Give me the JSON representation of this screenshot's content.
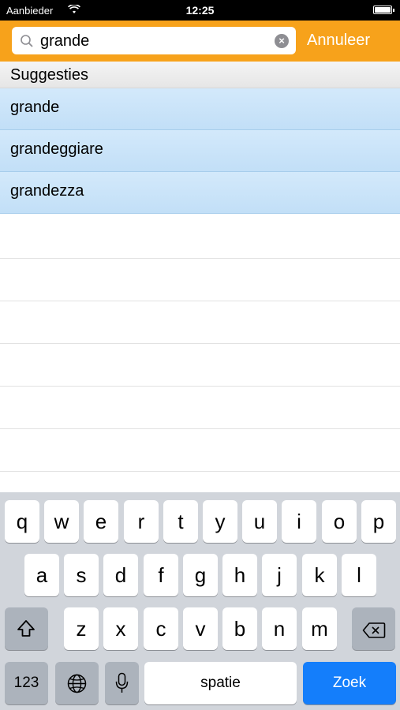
{
  "status_bar": {
    "carrier": "Aanbieder",
    "time": "12:25"
  },
  "search": {
    "query": "grande",
    "cancel_label": "Annuleer"
  },
  "suggestions_header": "Suggesties",
  "suggestions": [
    "grande",
    "grandeggiare",
    "grandezza"
  ],
  "keyboard": {
    "row1": [
      "q",
      "w",
      "e",
      "r",
      "t",
      "y",
      "u",
      "i",
      "o",
      "p"
    ],
    "row2": [
      "a",
      "s",
      "d",
      "f",
      "g",
      "h",
      "j",
      "k",
      "l"
    ],
    "row3": [
      "z",
      "x",
      "c",
      "v",
      "b",
      "n",
      "m"
    ],
    "numbers_label": "123",
    "space_label": "spatie",
    "search_label": "Zoek"
  },
  "colors": {
    "header": "#f7a21b",
    "selection": "#cfe6fa",
    "return_key": "#147efb"
  }
}
